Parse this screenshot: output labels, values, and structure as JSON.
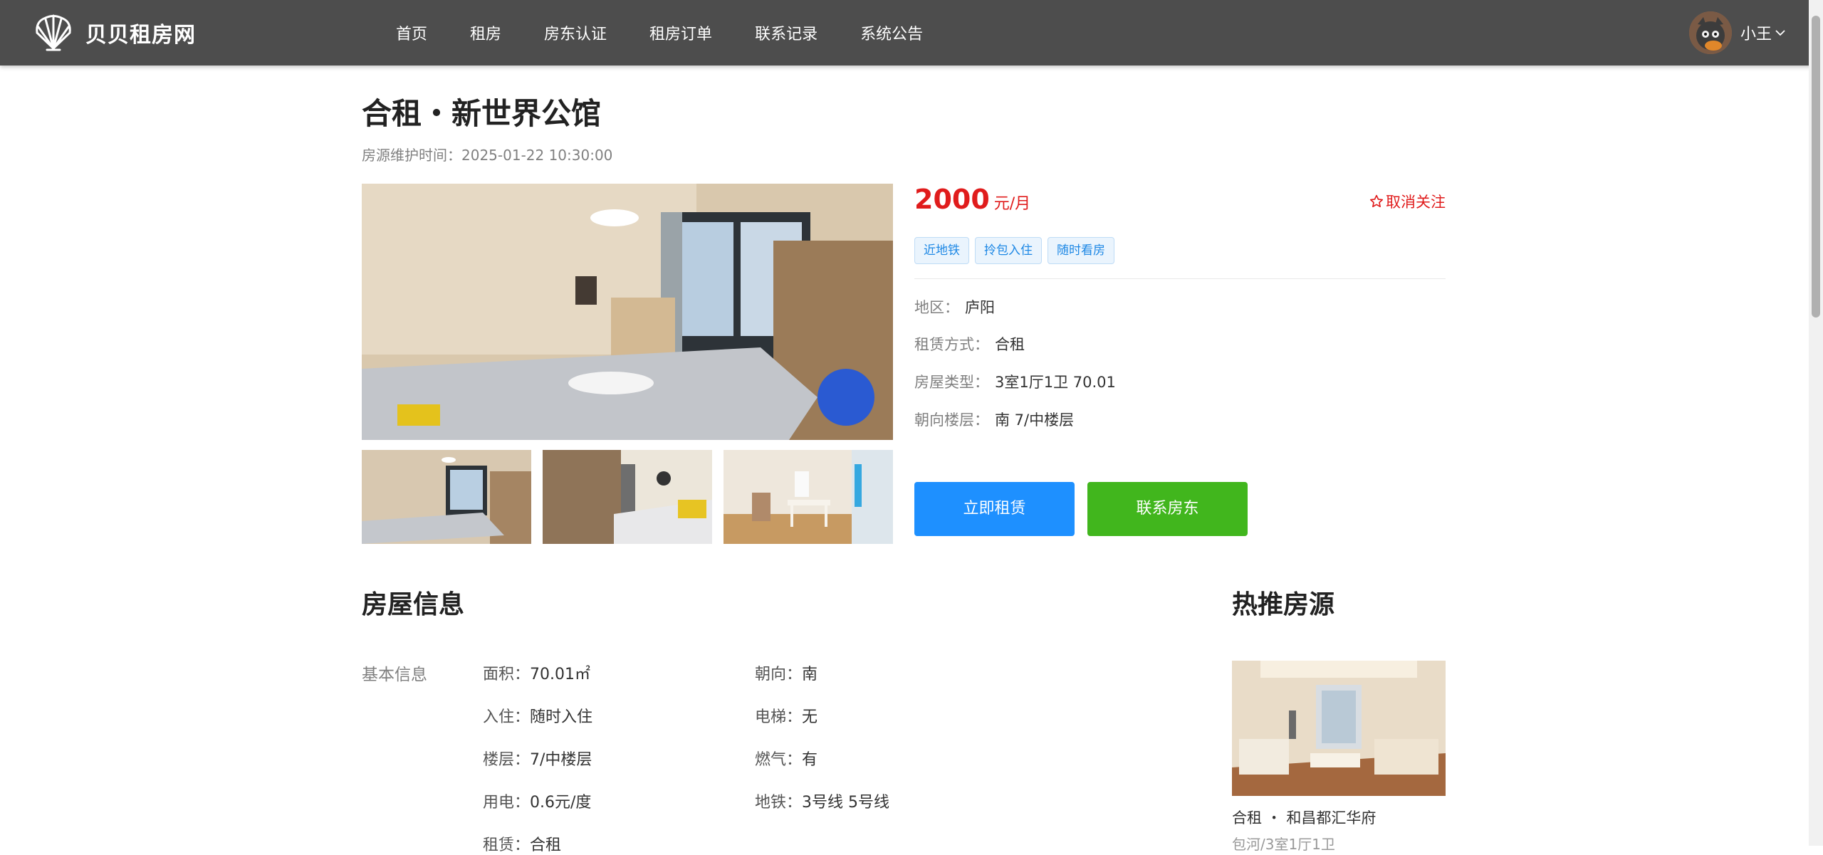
{
  "site": {
    "name": "贝贝租房网"
  },
  "nav": {
    "items": [
      {
        "label": "首页"
      },
      {
        "label": "租房"
      },
      {
        "label": "房东认证"
      },
      {
        "label": "租房订单"
      },
      {
        "label": "联系记录"
      },
      {
        "label": "系统公告"
      }
    ]
  },
  "user": {
    "name": "小王"
  },
  "house": {
    "title": "合租・新世界公馆",
    "maintain_time": "房源维护时间：2025-01-22 10:30:00",
    "price": "2000",
    "price_unit": "元/月",
    "follow_label": "取消关注",
    "tags": [
      {
        "label": "近地铁"
      },
      {
        "label": "拎包入住"
      },
      {
        "label": "随时看房"
      }
    ],
    "attrs": [
      {
        "key": "地区：",
        "value": "庐阳"
      },
      {
        "key": "租赁方式：",
        "value": "合租"
      },
      {
        "key": "房屋类型：",
        "value": "3室1厅1卫   70.01"
      },
      {
        "key": "朝向楼层：",
        "value": "南   7/中楼层"
      }
    ],
    "buttons": {
      "rent": "立即租赁",
      "contact": "联系房东"
    }
  },
  "house_info": {
    "title": "房屋信息",
    "basic_label": "基本信息",
    "left": [
      {
        "key": "面积：",
        "value": "70.01㎡"
      },
      {
        "key": "入住：",
        "value": "随时入住"
      },
      {
        "key": "楼层：",
        "value": "7/中楼层"
      },
      {
        "key": "用电：",
        "value": "0.6元/度"
      },
      {
        "key": "租赁：",
        "value": "合租"
      }
    ],
    "right": [
      {
        "key": "朝向：",
        "value": "南"
      },
      {
        "key": "电梯：",
        "value": "无"
      },
      {
        "key": "燃气：",
        "value": "有"
      },
      {
        "key": "地铁：",
        "value": "3号线   5号线"
      }
    ]
  },
  "hot": {
    "title": "热推房源",
    "items": [
      {
        "title": "合租 ・ 和昌都汇华府",
        "sub": "包河/3室1厅1卫"
      }
    ]
  },
  "colors": {
    "accent": "#1e90ff",
    "price": "#e01c1c",
    "contact": "#41b61d",
    "topbar": "#4d4d4d"
  }
}
